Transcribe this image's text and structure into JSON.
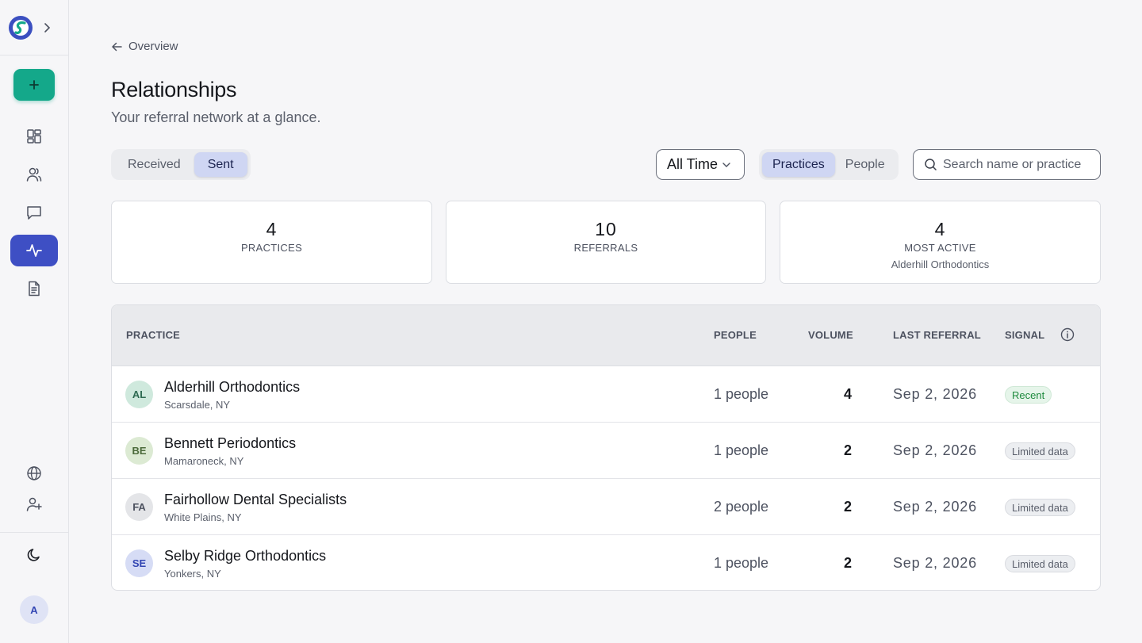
{
  "sidebar": {
    "nav": [
      "dashboard",
      "contacts",
      "messages",
      "relationships",
      "documents"
    ],
    "active": "relationships",
    "user_initial": "A"
  },
  "back_link": "Overview",
  "title": "Relationships",
  "subtitle": "Your referral network at a glance.",
  "direction_toggle": {
    "options": [
      "Received",
      "Sent"
    ],
    "selected": "Sent"
  },
  "time_filter": "All Time",
  "view_toggle": {
    "options": [
      "Practices",
      "People"
    ],
    "selected": "Practices"
  },
  "search": {
    "placeholder": "Search name or practice"
  },
  "stats": [
    {
      "value": "4",
      "label": "PRACTICES"
    },
    {
      "value": "10",
      "label": "REFERRALS"
    },
    {
      "value": "4",
      "label": "MOST ACTIVE",
      "sub": "Alderhill Orthodontics"
    }
  ],
  "table": {
    "headers": {
      "practice": "PRACTICE",
      "people": "PEOPLE",
      "volume": "VOLUME",
      "last_referral": "LAST REFERRAL",
      "signal": "SIGNAL"
    },
    "rows": [
      {
        "initials": "AL",
        "name": "Alderhill Orthodontics",
        "location": "Scarsdale, NY",
        "people": "1 people",
        "volume": "4",
        "last": "Sep 2, 2026",
        "signal": "Recent"
      },
      {
        "initials": "BE",
        "name": "Bennett Periodontics",
        "location": "Mamaroneck, NY",
        "people": "1 people",
        "volume": "2",
        "last": "Sep 2, 2026",
        "signal": "Limited data"
      },
      {
        "initials": "FA",
        "name": "Fairhollow Dental Specialists",
        "location": "White Plains, NY",
        "people": "2 people",
        "volume": "2",
        "last": "Sep 2, 2026",
        "signal": "Limited data"
      },
      {
        "initials": "SE",
        "name": "Selby Ridge Orthodontics",
        "location": "Yonkers, NY",
        "people": "1 people",
        "volume": "2",
        "last": "Sep 2, 2026",
        "signal": "Limited data"
      }
    ]
  },
  "colors": {
    "accent": "#3e4fc4",
    "new_button": "#14a88a",
    "recent_badge": "#1d8a3d"
  }
}
